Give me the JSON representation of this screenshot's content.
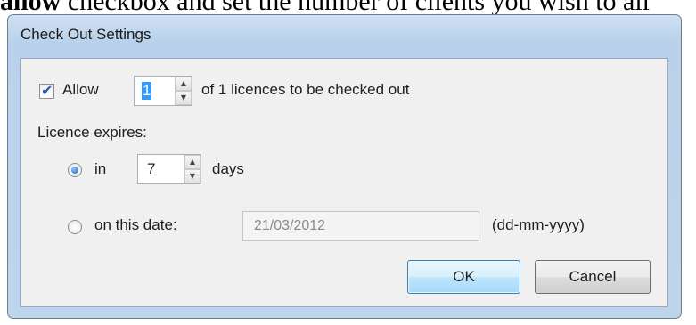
{
  "document": {
    "visible_text_bold": "allow",
    "visible_text_rest": " checkbox and set the number of clients you wish to all"
  },
  "dialog": {
    "title": "Check Out Settings",
    "allow": {
      "label": "Allow",
      "checked": true,
      "value": "1",
      "suffix": "of 1 licences to be checked out"
    },
    "expires_label": "Licence expires:",
    "in_option": {
      "label": "in",
      "selected": true,
      "value": "7",
      "unit": "days"
    },
    "date_option": {
      "label": "on this date:",
      "selected": false,
      "value": "21/03/2012",
      "format_hint": "(dd-mm-yyyy)"
    },
    "ok_label": "OK",
    "cancel_label": "Cancel"
  }
}
